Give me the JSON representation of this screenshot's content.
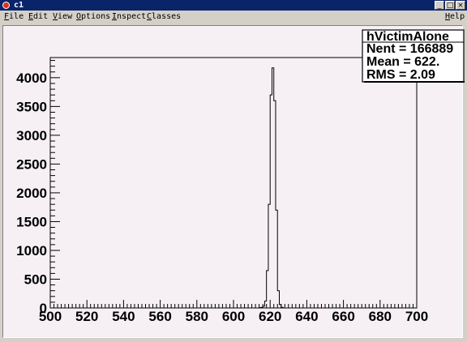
{
  "window": {
    "title": "c1",
    "buttons": [
      "_",
      "□",
      "×"
    ]
  },
  "menu": {
    "items": [
      "File",
      "Edit",
      "View",
      "Options",
      "Inspect",
      "Classes"
    ],
    "help": "Help"
  },
  "stats": {
    "name": "hVictimAlone",
    "entries_label": "Nent = 166889",
    "mean_label": "Mean  =  622.",
    "rms_label": "RMS   =  2.09"
  },
  "chart_data": {
    "type": "bar",
    "style": "step-histogram",
    "title": "",
    "xlabel": "",
    "ylabel": "",
    "xlim": [
      500,
      700
    ],
    "ylim": [
      0,
      4350
    ],
    "x_ticks": [
      500,
      520,
      540,
      560,
      580,
      600,
      620,
      640,
      660,
      680,
      700
    ],
    "y_ticks": [
      0,
      500,
      1000,
      1500,
      2000,
      2500,
      3000,
      3500,
      4000
    ],
    "bin_width": 1,
    "bin_edges_start": 614,
    "values": [
      5,
      10,
      30,
      120,
      650,
      1800,
      3700,
      4170,
      3600,
      1700,
      300,
      60,
      10
    ],
    "colors": {
      "line": "#000000",
      "background": "#f6f0f4"
    }
  }
}
